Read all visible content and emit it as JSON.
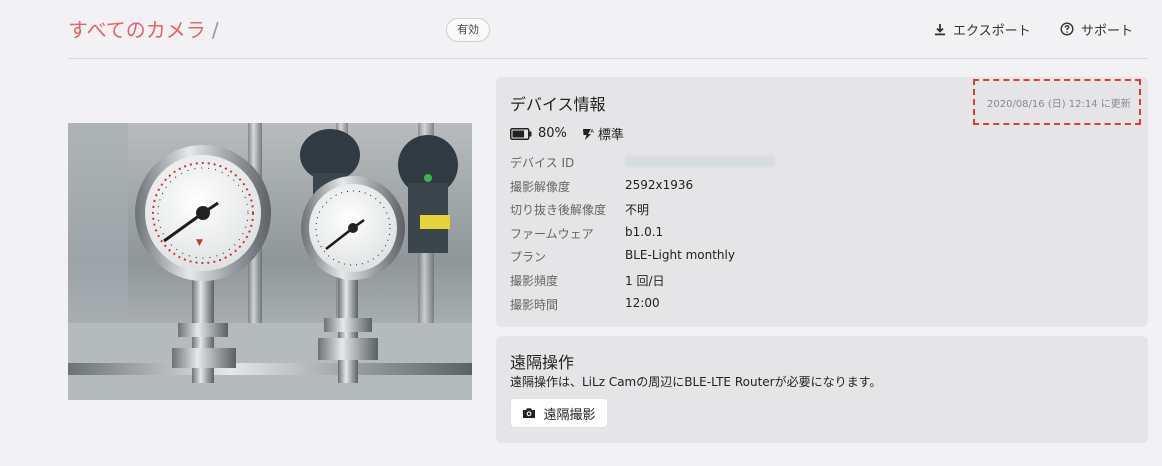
{
  "header": {
    "breadcrumb_link": "すべてのカメラ",
    "breadcrumb_separator": "/",
    "status_badge": "有効",
    "export_label": "エクスポート",
    "support_label": "サポート"
  },
  "device_info": {
    "title": "デバイス情報",
    "updated": "2020/08/16 (日) 12:14 に更新",
    "battery": "80%",
    "battery_level": 0.8,
    "power_mode": "標準",
    "rows": [
      {
        "label": "デバイス ID",
        "value": ""
      },
      {
        "label": "撮影解像度",
        "value": "2592x1936"
      },
      {
        "label": "切り抜き後解像度",
        "value": "不明"
      },
      {
        "label": "ファームウェア",
        "value": "b1.0.1"
      },
      {
        "label": "プラン",
        "value": "BLE-Light monthly"
      },
      {
        "label": "撮影頻度",
        "value": "1 回/日"
      },
      {
        "label": "撮影時間",
        "value": "12:00"
      }
    ]
  },
  "remote": {
    "title": "遠隔操作",
    "description": "遠隔操作は、LiLz Camの周辺にBLE-LTE Routerが必要になります。",
    "button_label": "遠隔撮影"
  },
  "icons": {
    "export": "download-icon",
    "support": "help-circle-icon",
    "battery": "battery-icon",
    "power": "bolt-icon",
    "camera": "camera-icon"
  },
  "colors": {
    "accent": "#e8626c",
    "highlight_border": "#d9402f",
    "card_bg": "#e5e5e8",
    "page_bg": "#f2f2f4"
  }
}
